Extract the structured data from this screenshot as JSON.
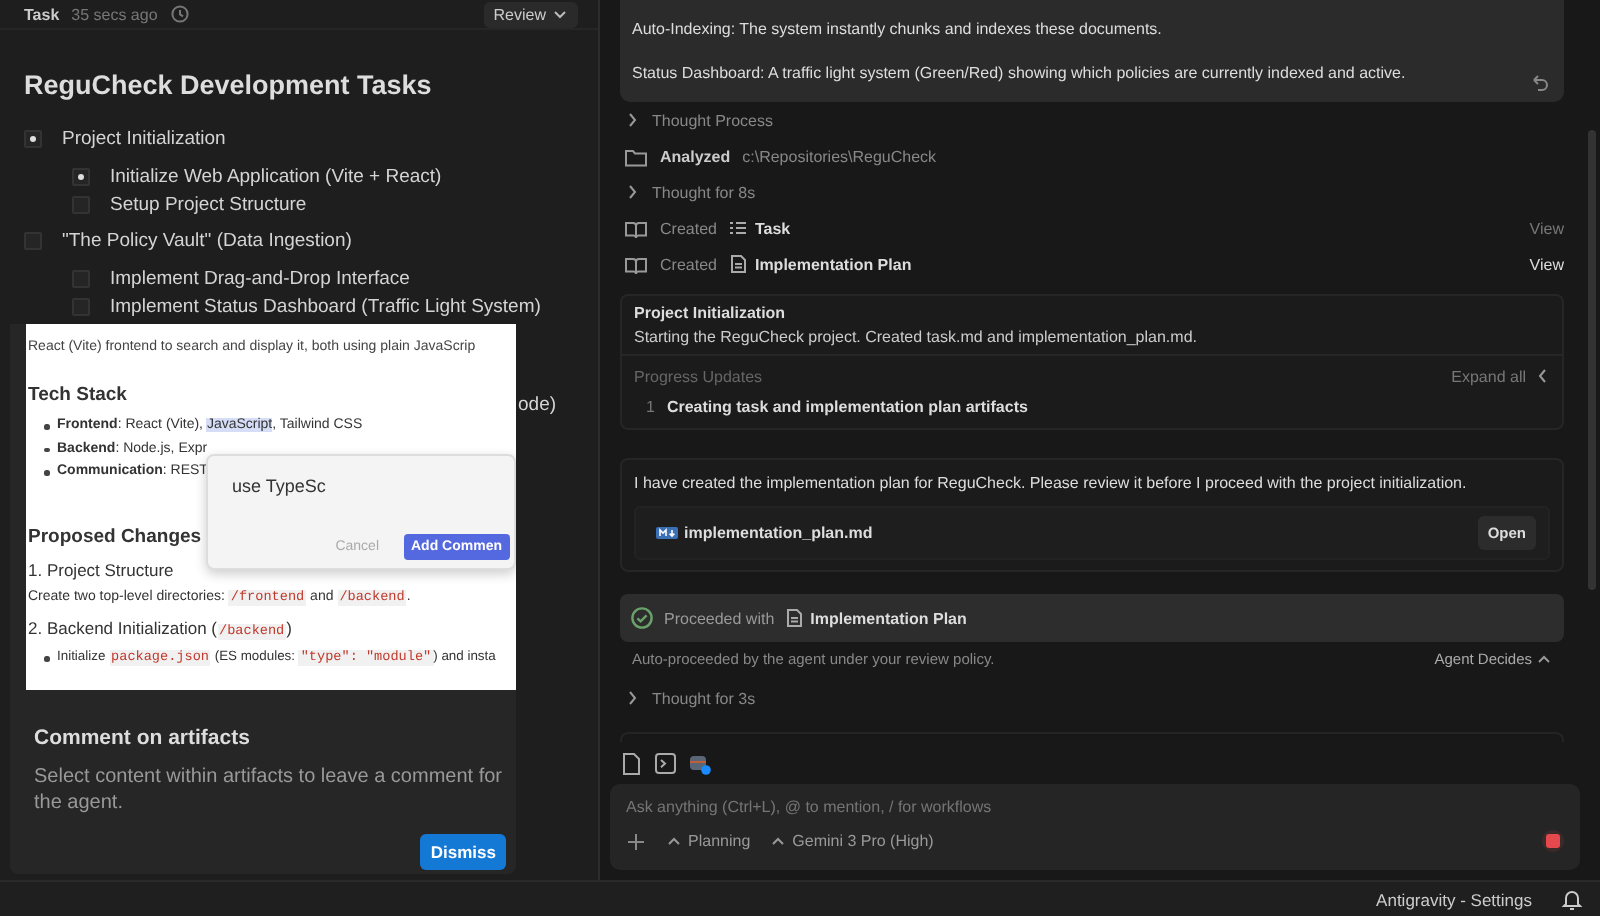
{
  "task_panel": {
    "label": "Task",
    "time": "35 secs ago",
    "review_button": "Review",
    "title": "ReguCheck Development Tasks",
    "tasks": [
      {
        "text": "Project Initialization",
        "in_progress": true,
        "children": [
          {
            "text": "Initialize Web Application (Vite + React)",
            "in_progress": true
          },
          {
            "text": "Setup Project Structure",
            "in_progress": false
          }
        ]
      },
      {
        "text": "\"The Policy Vault\" (Data Ingestion)",
        "in_progress": false,
        "children": [
          {
            "text": "Implement Drag-and-Drop Interface",
            "in_progress": false
          },
          {
            "text": "Implement Status Dashboard (Traffic Light System)",
            "in_progress": false
          }
        ]
      }
    ],
    "covered_task_tail": "ode)"
  },
  "artifact_popup": {
    "intro": "React (Vite) frontend to search and display it, both using plain JavaScrip",
    "heading_1": "Tech Stack",
    "bullets": [
      {
        "parts": [
          {
            "kind": "text",
            "text": "**Frontend**: React (Vite), "
          },
          {
            "kind": "highlight",
            "text": "JavaScript"
          },
          {
            "kind": "text",
            "text": ", Tailwind CSS"
          }
        ]
      },
      {
        "parts": [
          {
            "kind": "text",
            "text": "**Backend**: Node.js, Expr"
          }
        ]
      },
      {
        "parts": [
          {
            "kind": "text",
            "text": "**Communication**: REST"
          }
        ]
      }
    ],
    "heading_2": "Proposed Changes",
    "subheading_1": "1. Project Structure",
    "paragraph": [
      {
        "kind": "text",
        "text": "Create two top-level directories: "
      },
      {
        "kind": "code",
        "text": "/frontend"
      },
      {
        "kind": "text",
        "text": " and "
      },
      {
        "kind": "code",
        "text": "/backend"
      },
      {
        "kind": "text",
        "text": "."
      }
    ],
    "subheading_2": [
      {
        "kind": "text",
        "text": "2. Backend Initialization ("
      },
      {
        "kind": "code",
        "text": "/backend"
      },
      {
        "kind": "text",
        "text": ")"
      }
    ],
    "bullet_2": [
      {
        "kind": "text",
        "text": "Initialize "
      },
      {
        "kind": "code",
        "text": "package.json"
      },
      {
        "kind": "text",
        "text": " (ES modules: "
      },
      {
        "kind": "code",
        "text": "\"type\": \"module\""
      },
      {
        "kind": "text",
        "text": ") and insta"
      }
    ],
    "comment_box": {
      "value": "use TypeSc",
      "cancel": "Cancel",
      "submit": "Add Commen"
    },
    "hint": {
      "title": "Comment on artifacts",
      "text": "Select content within artifacts to leave a comment for the agent.",
      "button": "Dismiss"
    }
  },
  "conversation": {
    "request_card": {
      "lines": [
        "Auto-Indexing: The system instantly chunks and indexes these documents.",
        "Status Dashboard: A traffic light system (Green/Red) showing which policies are currently indexed and active."
      ]
    },
    "steps": [
      {
        "kind": "thought",
        "text": "Thought Process"
      },
      {
        "kind": "analyzed",
        "label": "Analyzed",
        "path": "c:\\Repositories\\ReguCheck"
      },
      {
        "kind": "thought",
        "text": "Thought for 8s"
      },
      {
        "kind": "created",
        "label": "Created",
        "artifact": {
          "kind": "task",
          "name": "Task"
        },
        "action": "View",
        "highlighted": false
      },
      {
        "kind": "created",
        "label": "Created",
        "artifact": {
          "kind": "document",
          "name": "Implementation Plan"
        },
        "action": "View",
        "highlighted": true
      }
    ],
    "task_card": {
      "title": "Project Initialization",
      "summary": "Starting the ReguCheck project. Created task.md and implementation_plan.md.",
      "progress_label": "Progress Updates",
      "expand": "Expand all",
      "updates": [
        {
          "number": "1",
          "text": "Creating task and implementation plan artifacts"
        }
      ]
    },
    "message": {
      "text": "I have created the implementation plan for ReguCheck. Please review it before I proceed with the project initialization.",
      "file": "implementation_plan.md",
      "open_button": "Open"
    },
    "proceeded": {
      "label": "Proceeded with",
      "artifact": "Implementation Plan",
      "note": "Auto-proceeded by the agent under your review policy.",
      "policy": "Agent Decides"
    },
    "last_step": {
      "kind": "thought",
      "text": "Thought for 3s"
    },
    "composer": {
      "placeholder": "Ask anything (Ctrl+L), @ to mention, / for workflows",
      "mode": "Planning",
      "model": "Gemini 3 Pro (High)"
    }
  },
  "status_bar": {
    "text": "Antigravity - Settings"
  }
}
